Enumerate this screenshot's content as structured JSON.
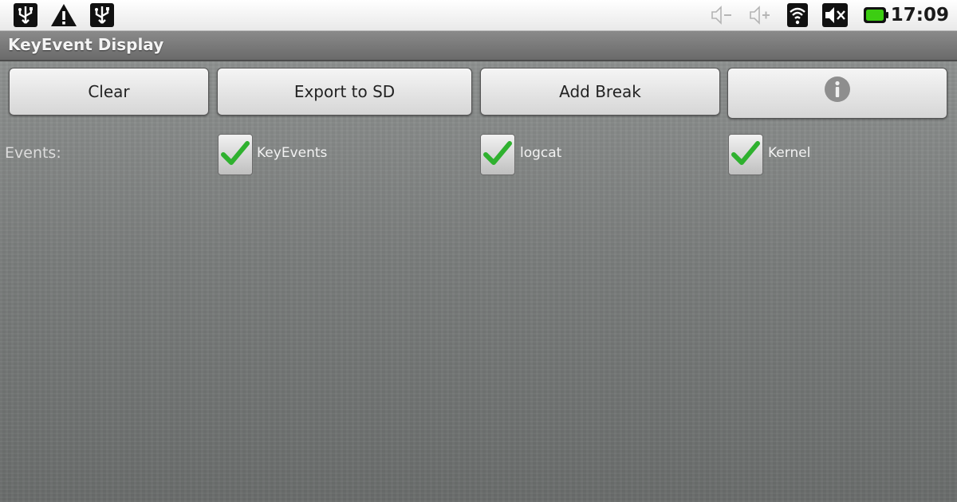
{
  "status_bar": {
    "time": "17:09",
    "icons": [
      "usb-icon",
      "warning-icon",
      "usb-icon",
      "volume-down-icon",
      "volume-up-icon",
      "wifi-icon",
      "mute-icon",
      "battery-icon"
    ]
  },
  "app": {
    "title": "KeyEvent Display"
  },
  "toolbar": {
    "clear_label": "Clear",
    "export_label": "Export to SD",
    "break_label": "Add Break",
    "info_icon": "info-icon"
  },
  "events": {
    "label": "Events:",
    "options": [
      {
        "label": "KeyEvents",
        "checked": true
      },
      {
        "label": "logcat",
        "checked": true
      },
      {
        "label": "Kernel",
        "checked": true
      }
    ]
  },
  "colors": {
    "check_green": "#2fb12f",
    "background": "#7d807f"
  }
}
